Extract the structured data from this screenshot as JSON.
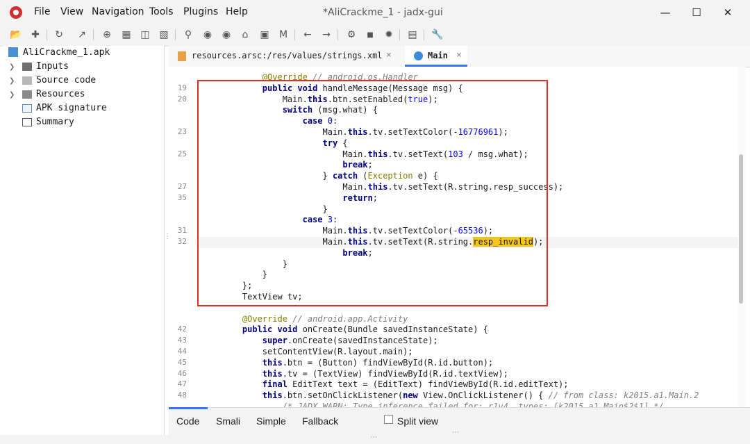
{
  "window": {
    "title": "*AliCrackme_1 - jadx-gui",
    "minimize": "—",
    "maximize": "☐",
    "close": "✕"
  },
  "menu": [
    "File",
    "View",
    "Navigation",
    "Tools",
    "Plugins",
    "Help"
  ],
  "tree": {
    "root": "AliCrackme_1.apk",
    "items": [
      "Inputs",
      "Source code",
      "Resources",
      "APK signature",
      "Summary"
    ]
  },
  "tabs": [
    {
      "label": "resources.arsc:/res/values/strings.xml",
      "close": "×"
    },
    {
      "label": "Main",
      "close": "×"
    }
  ],
  "code": {
    "lines": [
      {
        "n": "",
        "t": "        @Override // android.os.Handler"
      },
      {
        "n": "19",
        "t": "        public void handleMessage(Message msg) {"
      },
      {
        "n": "20",
        "t": "            Main.this.btn.setEnabled(true);"
      },
      {
        "n": "",
        "t": "            switch (msg.what) {"
      },
      {
        "n": "",
        "t": "                case 0:"
      },
      {
        "n": "23",
        "t": "                    Main.this.tv.setTextColor(-16776961);"
      },
      {
        "n": "",
        "t": "                    try {"
      },
      {
        "n": "25",
        "t": "                        Main.this.tv.setText(103 / msg.what);"
      },
      {
        "n": "",
        "t": "                        break;"
      },
      {
        "n": "",
        "t": "                    } catch (Exception e) {"
      },
      {
        "n": "27",
        "t": "                        Main.this.tv.setText(R.string.resp_success);"
      },
      {
        "n": "35",
        "t": "                        return;"
      },
      {
        "n": "",
        "t": "                    }"
      },
      {
        "n": "",
        "t": "                case 3:"
      },
      {
        "n": "31",
        "t": "                    Main.this.tv.setTextColor(-65536);"
      },
      {
        "n": "32",
        "t": "                    Main.this.tv.setText(R.string.resp_invalid);"
      },
      {
        "n": "",
        "t": "                        break;"
      },
      {
        "n": "",
        "t": "            }"
      },
      {
        "n": "",
        "t": "        }"
      },
      {
        "n": "",
        "t": "    };"
      },
      {
        "n": "",
        "t": "    TextView tv;"
      },
      {
        "n": "",
        "t": ""
      },
      {
        "n": "",
        "t": "    @Override // android.app.Activity"
      },
      {
        "n": "42",
        "t": "    public void onCreate(Bundle savedInstanceState) {"
      },
      {
        "n": "43",
        "t": "        super.onCreate(savedInstanceState);"
      },
      {
        "n": "44",
        "t": "        setContentView(R.layout.main);"
      },
      {
        "n": "45",
        "t": "        this.btn = (Button) findViewById(R.id.button);"
      },
      {
        "n": "46",
        "t": "        this.tv = (TextView) findViewById(R.id.textView);"
      },
      {
        "n": "47",
        "t": "        final EditText text = (EditText) findViewById(R.id.editText);"
      },
      {
        "n": "48",
        "t": "        this.btn.setOnClickListener(new View.OnClickListener() { // from class: k2015.a1.Main.2"
      },
      {
        "n": "",
        "t": "            /* JADX WARN: Type inference failed for: r1v4, types: [k2015.a1.Main$2$1] */"
      }
    ],
    "highlight": "resp_invalid"
  },
  "bottom_tabs": [
    "Code",
    "Smali",
    "Simple",
    "Fallback"
  ],
  "split_view": "Split view",
  "colors": {
    "accent": "#3574f0",
    "redbox": "#e0302a",
    "highlight": "#f5c518"
  }
}
